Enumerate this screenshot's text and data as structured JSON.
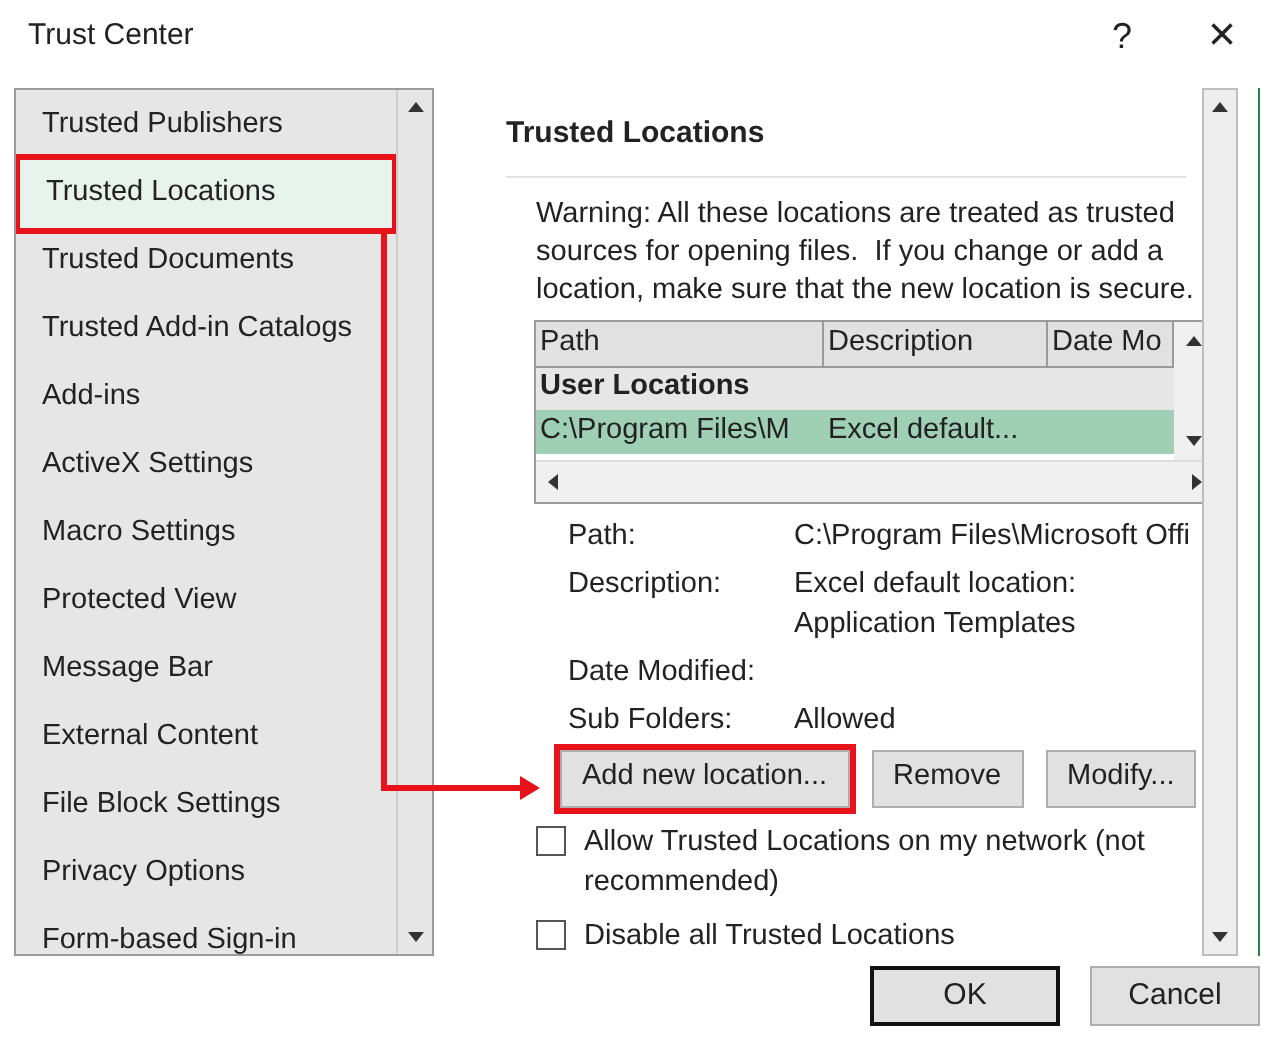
{
  "window": {
    "title": "Trust Center",
    "help": "?",
    "close": "×"
  },
  "sidebar": {
    "items": [
      {
        "label": "Trusted Publishers",
        "selected": false,
        "highlighted": false
      },
      {
        "label": "Trusted Locations",
        "selected": true,
        "highlighted": true
      },
      {
        "label": "Trusted Documents",
        "selected": false,
        "highlighted": false
      },
      {
        "label": "Trusted Add-in Catalogs",
        "selected": false,
        "highlighted": false
      },
      {
        "label": "Add-ins",
        "selected": false,
        "highlighted": false
      },
      {
        "label": "ActiveX Settings",
        "selected": false,
        "highlighted": false
      },
      {
        "label": "Macro Settings",
        "selected": false,
        "highlighted": false
      },
      {
        "label": "Protected View",
        "selected": false,
        "highlighted": false
      },
      {
        "label": "Message Bar",
        "selected": false,
        "highlighted": false
      },
      {
        "label": "External Content",
        "selected": false,
        "highlighted": false
      },
      {
        "label": "File Block Settings",
        "selected": false,
        "highlighted": false
      },
      {
        "label": "Privacy Options",
        "selected": false,
        "highlighted": false
      },
      {
        "label": "Form-based Sign-in",
        "selected": false,
        "highlighted": false
      }
    ]
  },
  "panel": {
    "heading": "Trusted Locations",
    "warning": "Warning: All these locations are treated as trusted sources for opening files.  If you change or add a location, make sure that the new location is secure.",
    "table": {
      "columns": [
        "Path",
        "Description",
        "Date Mo"
      ],
      "group": "User Locations",
      "rows": [
        {
          "cells": [
            "C:\\Program Files\\M",
            "Excel default..."
          ],
          "selected": true
        }
      ]
    },
    "details": [
      {
        "label": "Path:",
        "value": "C:\\Program Files\\Microsoft Offi"
      },
      {
        "label": "Description:",
        "value": "Excel default location: Application Templates"
      },
      {
        "label": "Date Modified:"
      },
      {
        "label": "Sub Folders:",
        "value": "Allowed"
      }
    ],
    "buttons": [
      {
        "label": "Add new location...",
        "highlighted": true
      },
      {
        "label": "Remove",
        "highlighted": false
      },
      {
        "label": "Modify...",
        "highlighted": false
      }
    ],
    "checkboxes": [
      {
        "label": "Allow Trusted Locations on my network (not recommended)",
        "checked": false
      },
      {
        "label": "Disable all Trusted Locations",
        "checked": false
      }
    ]
  },
  "footer": {
    "buttons": [
      {
        "label": "OK",
        "default": true
      },
      {
        "label": "Cancel",
        "default": false
      }
    ]
  },
  "annotation": {
    "arrow": true
  }
}
